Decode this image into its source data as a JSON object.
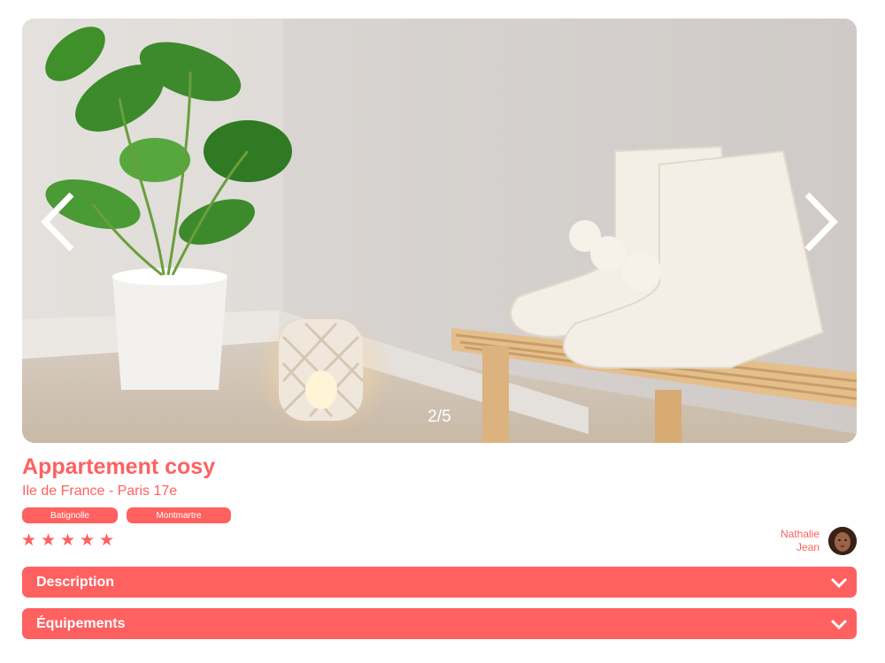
{
  "gallery": {
    "counter": "2/5",
    "prev_icon": "chevron-left-icon",
    "next_icon": "chevron-right-icon"
  },
  "listing": {
    "title": "Appartement cosy",
    "location": "Ile de France - Paris 17e",
    "tags": [
      "Batignolle",
      "Montmartre"
    ],
    "rating": 5,
    "rating_max": 5
  },
  "host": {
    "first_name": "Nathalie",
    "last_name": "Jean"
  },
  "sections": {
    "description_label": "Description",
    "equipment_label": "Équipements"
  },
  "colors": {
    "accent": "#ff6060",
    "on_accent": "#ffffff"
  }
}
